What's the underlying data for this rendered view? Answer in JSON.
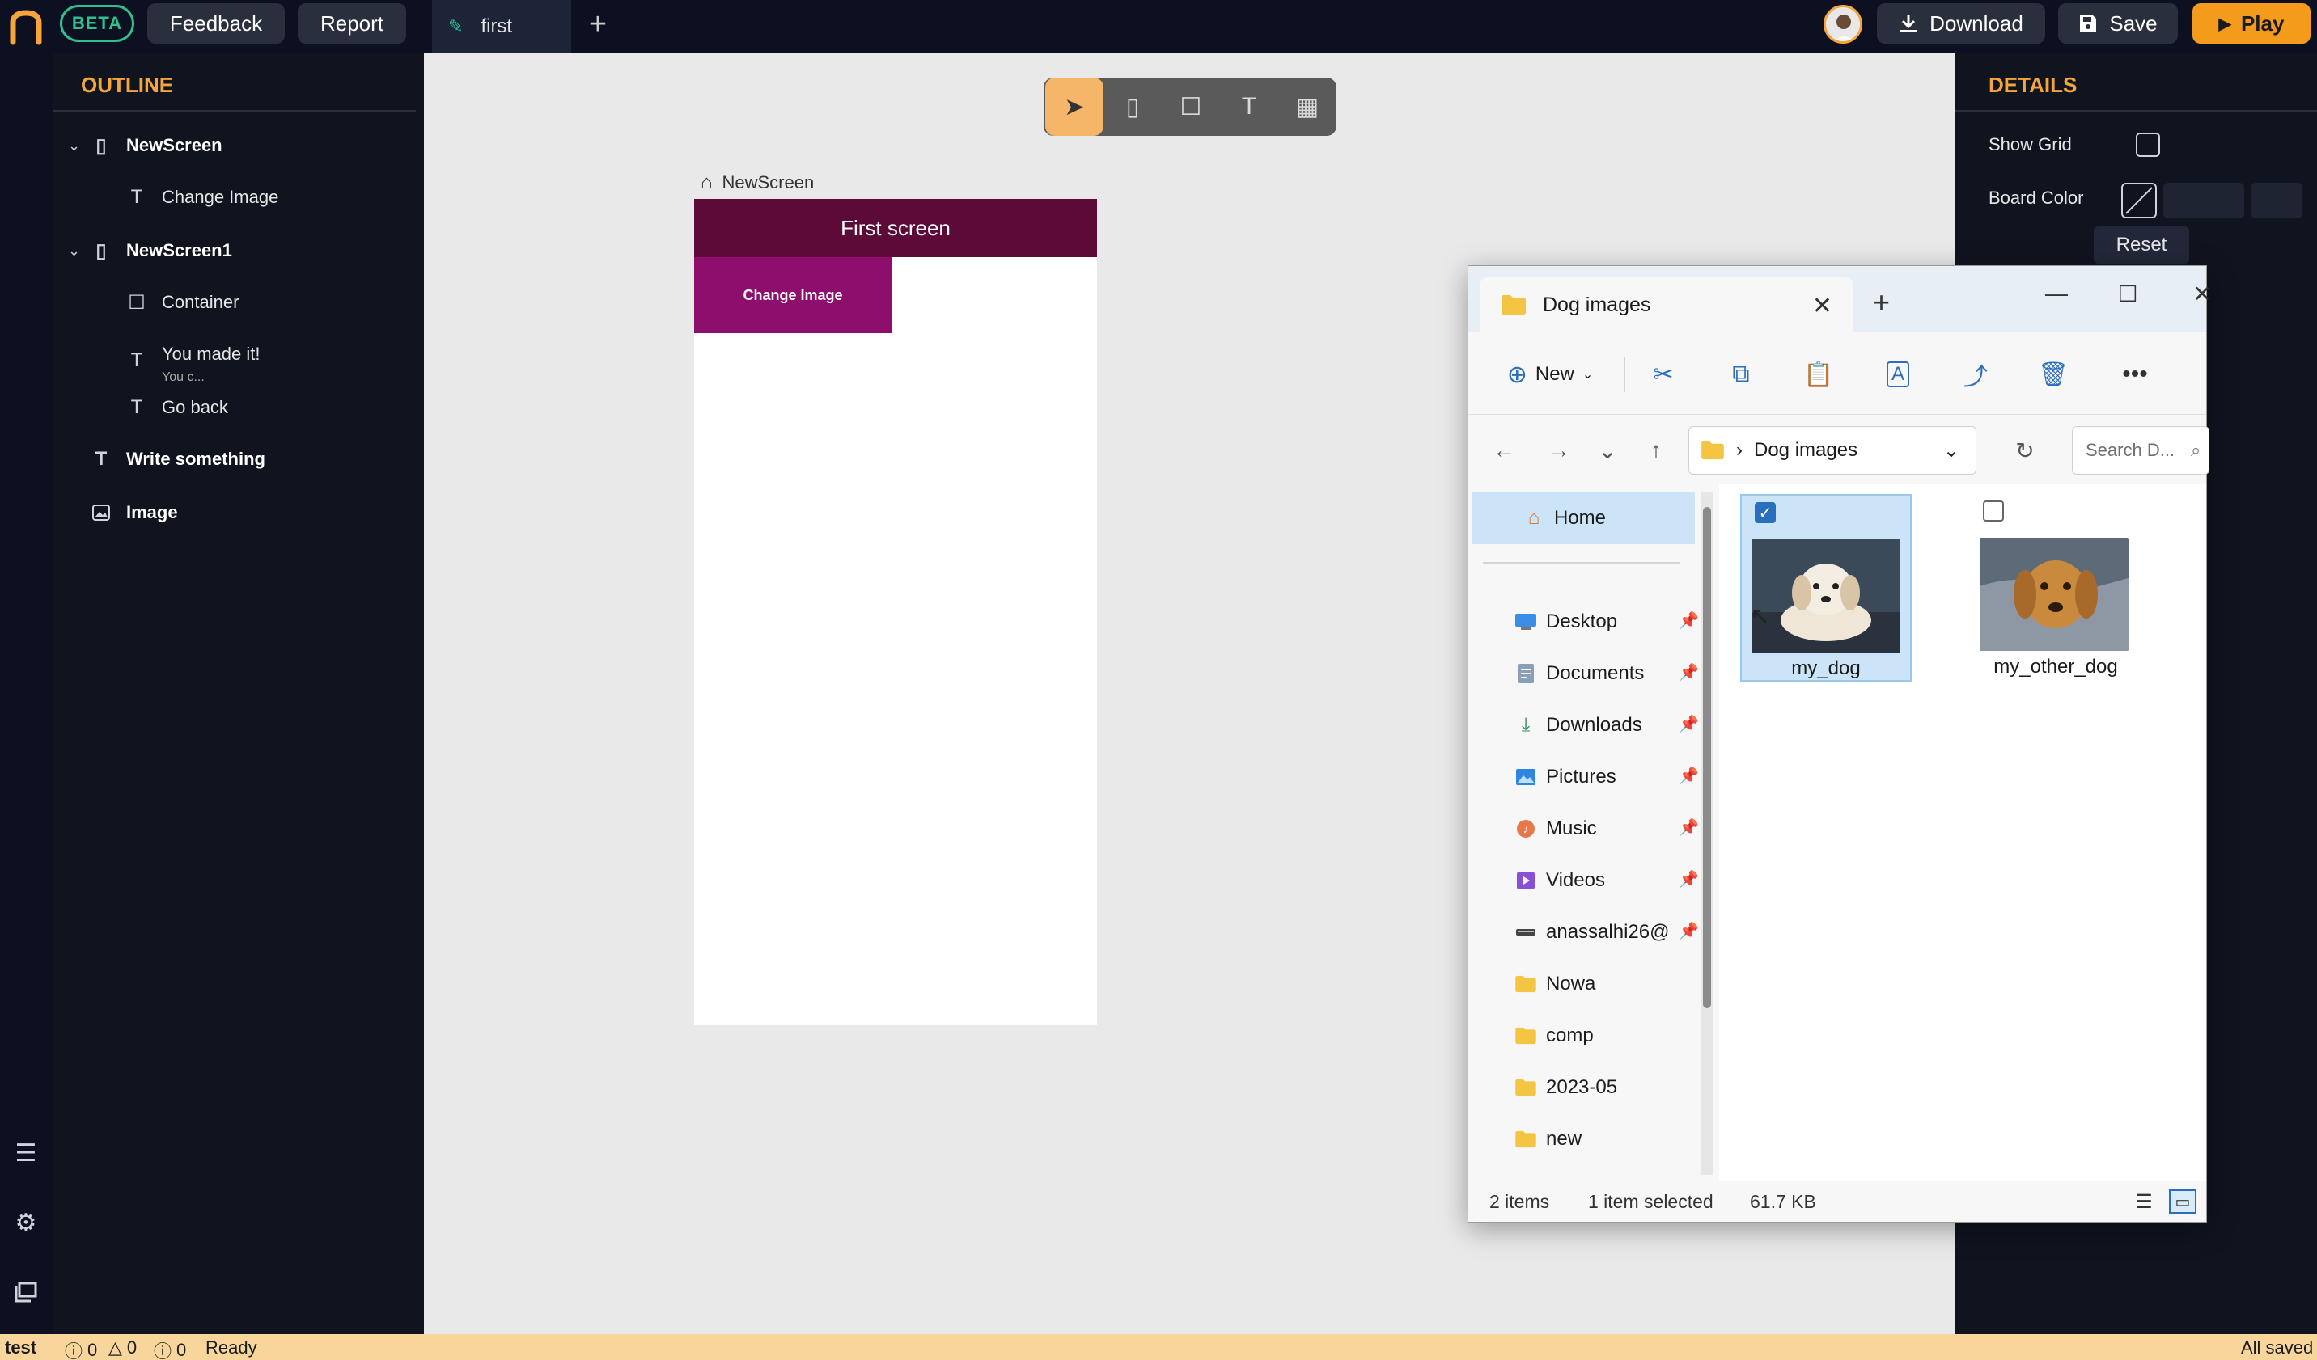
{
  "topbar": {
    "beta": "BETA",
    "feedback": "Feedback",
    "report": "Report",
    "tab_label": "first",
    "download": "Download",
    "save": "Save",
    "play": "Play"
  },
  "outline": {
    "title": "OUTLINE",
    "items": [
      {
        "label": "NewScreen"
      },
      {
        "label": "Change Image"
      },
      {
        "label": "NewScreen1"
      },
      {
        "label": "Container"
      },
      {
        "label": "You made it!"
      },
      {
        "label": "You c..."
      },
      {
        "label": "Go back"
      },
      {
        "label": "Write something"
      },
      {
        "label": "Image"
      }
    ]
  },
  "canvas": {
    "screen_label": "NewScreen",
    "appbar_title": "First screen",
    "change_button": "Change Image"
  },
  "details": {
    "title": "DETAILS",
    "show_grid": "Show Grid",
    "board_color": "Board Color",
    "reset": "Reset"
  },
  "statusbar": {
    "project": "test",
    "errors": "0",
    "warnings": "0",
    "infos": "0",
    "state": "Ready",
    "saved": "All saved"
  },
  "explorer": {
    "tab_title": "Dog images",
    "new_label": "New",
    "address": "Dog images",
    "search_placeholder": "Search D...",
    "sidebar": [
      {
        "label": "Home",
        "icon": "home-icon"
      },
      {
        "label": "Desktop",
        "icon": "desktop-icon"
      },
      {
        "label": "Documents",
        "icon": "documents-icon"
      },
      {
        "label": "Downloads",
        "icon": "downloads-icon"
      },
      {
        "label": "Pictures",
        "icon": "pictures-icon"
      },
      {
        "label": "Music",
        "icon": "music-icon"
      },
      {
        "label": "Videos",
        "icon": "videos-icon"
      },
      {
        "label": "anassalhi26@",
        "icon": "drive-icon"
      },
      {
        "label": "Nowa",
        "icon": "folder-icon"
      },
      {
        "label": "comp",
        "icon": "folder-icon"
      },
      {
        "label": "2023-05",
        "icon": "folder-icon"
      },
      {
        "label": "new",
        "icon": "folder-icon"
      }
    ],
    "files": [
      {
        "name": "my_dog",
        "selected": true
      },
      {
        "name": "my_other_dog",
        "selected": false
      }
    ],
    "status": {
      "count": "2 items",
      "selection": "1 item selected",
      "size": "61.7 KB"
    }
  },
  "colors": {
    "accent_orange": "#f59b1c",
    "outline_title": "#f5a53b",
    "beta_green": "#2fc08f",
    "appbar": "#5c0a38",
    "change_button": "#8e0e6e",
    "explorer_selection": "#cce4f7"
  }
}
